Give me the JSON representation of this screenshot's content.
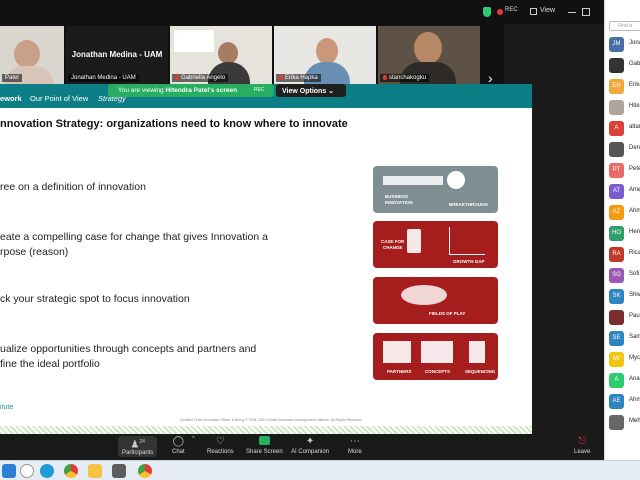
{
  "topbar": {
    "rec": "REC",
    "view": "View"
  },
  "participants_strip": [
    {
      "label": "Patel"
    },
    {
      "label": "Jonathan Medina - UAM",
      "name": "Jonathan Medina - UAM"
    },
    {
      "label": "Gabriella Angelo"
    },
    {
      "label": "Erika Hapka"
    },
    {
      "label": "stanchakogku"
    }
  ],
  "share_bar": {
    "prefix": "You are viewing ",
    "presenter": "Hitendra Patel's screen",
    "rec": "REC",
    "options": "View Options ⌄"
  },
  "slide": {
    "nav": [
      "ework",
      "Our Point of View",
      "Strategy"
    ],
    "title": "nnovation Strategy: organizations need to know where to innovate",
    "bullets": [
      [
        "ree on a definition of innovation"
      ],
      [
        "eate a compelling case for change that gives Innovation a",
        "rpose (reason)"
      ],
      [
        "ck your strategic spot to focus innovation"
      ],
      [
        "ualize opportunities through concepts and partners and",
        "fine the ideal portfolio"
      ]
    ],
    "cards": {
      "c1": [
        "BUSINESS",
        "INNOVATION",
        "BREAKTHROUGH"
      ],
      "c2": [
        "CASE FOR",
        "CHANGE",
        "GROWTH GAP"
      ],
      "c3": [
        "FIELDS OF PLAY"
      ],
      "c4": [
        "PARTNERS",
        "CONCEPTS",
        "SEQUENCING"
      ]
    },
    "logo": "itute",
    "footer": "Certified Chief Innovation Officer Training  © 2008- 2021 Global Innovation Management Institute. All Rights Reserved."
  },
  "panel": {
    "find_placeholder": "Find a",
    "people": [
      {
        "initials": "JM",
        "name": "Jona",
        "color": "#4a6fa5"
      },
      {
        "initials": "",
        "name": "Gab",
        "color": "#333333"
      },
      {
        "initials": "EH",
        "name": "Erika",
        "color": "#f2a93b"
      },
      {
        "initials": "",
        "name": "Hite",
        "color": "#b0a49a"
      },
      {
        "initials": "A",
        "name": "altar",
        "color": "#d9433a"
      },
      {
        "initials": "",
        "name": "Den",
        "color": "#555555"
      },
      {
        "initials": "PT",
        "name": "Pete",
        "color": "#e86a6a"
      },
      {
        "initials": "AT",
        "name": "Ame",
        "color": "#7a5bd1"
      },
      {
        "initials": "AZ",
        "name": "Ahm",
        "color": "#f39c12"
      },
      {
        "initials": "HO",
        "name": "Hen",
        "color": "#2e9e6b"
      },
      {
        "initials": "RA",
        "name": "Rica",
        "color": "#c0392b"
      },
      {
        "initials": "SG",
        "name": "Sofi",
        "color": "#9b59b6"
      },
      {
        "initials": "SK",
        "name": "Shiv",
        "color": "#2e86c1"
      },
      {
        "initials": "",
        "name": "Paul",
        "color": "#7a2d2d"
      },
      {
        "initials": "SE",
        "name": "Sam",
        "color": "#2e86c1"
      },
      {
        "initials": "MI",
        "name": "Myc",
        "color": "#f1c40f"
      },
      {
        "initials": "A",
        "name": "Ana",
        "color": "#2ecc71"
      },
      {
        "initials": "AE",
        "name": "Ahm",
        "color": "#2e86c1"
      },
      {
        "initials": "",
        "name": "Meh",
        "color": "#666666"
      }
    ]
  },
  "controls": {
    "participants": "Participants",
    "participants_count": "24",
    "chat": "Chat",
    "reactions": "Reactions",
    "share": "Share Screen",
    "ai": "AI Companion",
    "more": "More",
    "leave": "Leave"
  }
}
